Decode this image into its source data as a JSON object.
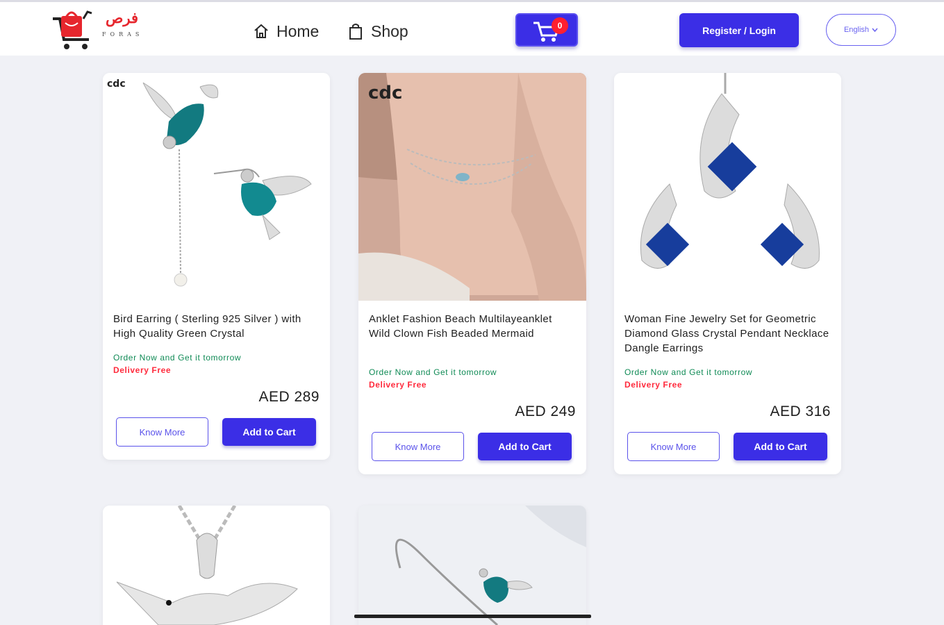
{
  "header": {
    "logo_arabic": "فرص",
    "logo_latin": "FORAS",
    "nav": [
      {
        "label": "Home",
        "icon": "home-icon"
      },
      {
        "label": "Shop",
        "icon": "shopping-bag-icon"
      }
    ],
    "cart": {
      "count": "0",
      "icon": "cart-icon"
    },
    "register_label": "Register / Login",
    "language": {
      "selected": "English",
      "icon": "chevron-down-icon"
    }
  },
  "products": [
    {
      "title": "Bird Earring ( Sterling 925 Silver ) with High Quality Green Crystal",
      "order_text": "Order Now and Get it tomorrow",
      "delivery_text": "Delivery Free",
      "price": "AED 289",
      "know_more": "Know More",
      "add_to_cart": "Add to Cart",
      "brand_mark": "cdc"
    },
    {
      "title": "Anklet Fashion Beach Multilayeanklet Wild Clown Fish Beaded Mermaid",
      "order_text": "Order Now and Get it tomorrow",
      "delivery_text": "Delivery Free",
      "price": "AED 249",
      "know_more": "Know More",
      "add_to_cart": "Add to Cart",
      "brand_mark": "cdc"
    },
    {
      "title": "Woman Fine Jewelry Set for Geometric Diamond Glass Crystal Pendant Necklace Dangle Earrings",
      "order_text": "Order Now and Get it tomorrow",
      "delivery_text": "Delivery Free",
      "price": "AED 316",
      "know_more": "Know More",
      "add_to_cart": "Add to Cart"
    }
  ],
  "colors": {
    "primary": "#3b2ee6",
    "order_green": "#0f8a55",
    "delivery_red": "#ff2a3c",
    "page_bg": "#f0f1f6",
    "logo_red": "#e6262d"
  }
}
